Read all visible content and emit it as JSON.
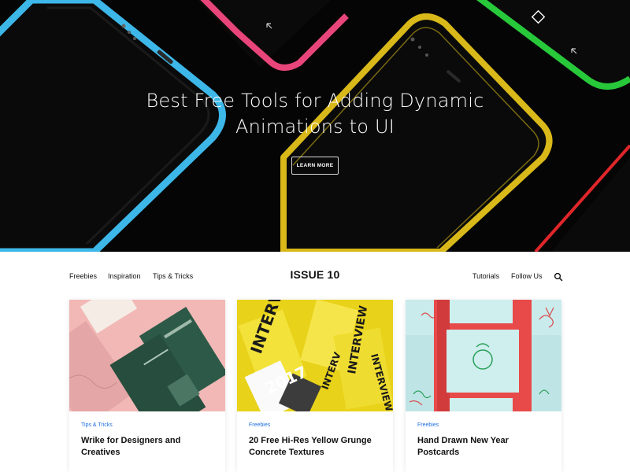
{
  "hero": {
    "title_line1": "Best Free Tools for Adding Dynamic",
    "title_line2": "Animations to UI",
    "button_label": "LEARN MORE"
  },
  "nav": {
    "left": [
      "Freebies",
      "Inspiration",
      "Tips & Tricks"
    ],
    "logo": "ISSUE 10",
    "right": [
      "Tutorials",
      "Follow Us"
    ]
  },
  "cards": [
    {
      "category": "Tips & Tricks",
      "title": "Wrike for Designers and Creatives"
    },
    {
      "category": "Freebies",
      "title": "20 Free Hi-Res Yellow Grunge Concrete Textures"
    },
    {
      "category": "Freebies",
      "title": "Hand Drawn New Year Postcards"
    }
  ],
  "colors": {
    "hero_bg": "#050505",
    "phone_blue": "#3db7e8",
    "phone_pink": "#e8457a",
    "phone_yellow": "#d9b81a",
    "phone_green": "#27c93a",
    "phone_red": "#e0262a",
    "category_link": "#1f6fe0"
  },
  "icons": [
    "expand-arrow-icon",
    "diamond-icon",
    "search-icon"
  ]
}
